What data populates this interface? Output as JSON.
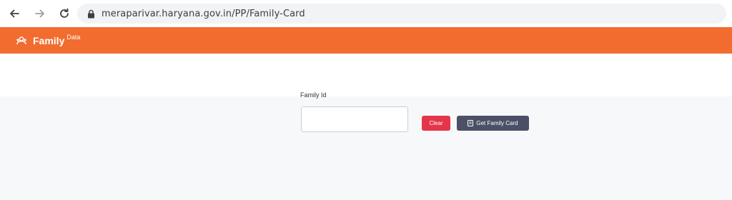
{
  "browser": {
    "url": "meraparivar.haryana.gov.in/PP/Family-Card",
    "icons": {
      "back": "arrow-left-icon",
      "forward": "arrow-right-icon",
      "reload": "reload-icon",
      "lock": "lock-icon"
    }
  },
  "header": {
    "brand": "Family",
    "brand_sub": "Data",
    "brand_icon": "family-logo-icon",
    "color": "#f26c2f"
  },
  "form": {
    "family_id_label": "Family Id",
    "family_id_value": "",
    "family_id_placeholder": "",
    "clear_label": "Clear",
    "get_card_label": "Get Family Card",
    "get_card_icon": "card-icon",
    "clear_color": "#e5354a",
    "get_card_color": "#4b5066"
  }
}
